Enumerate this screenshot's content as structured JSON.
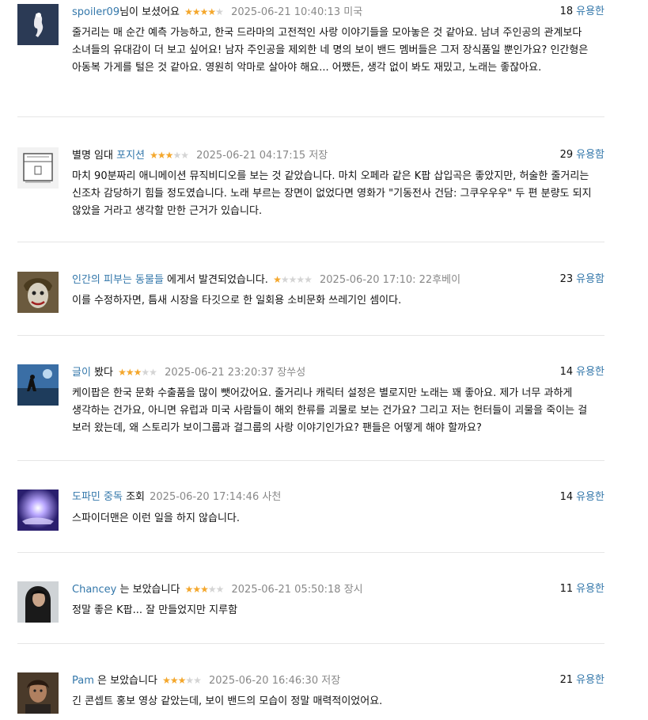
{
  "reviews": [
    {
      "avatar": "ghost-figure-avatar",
      "user": "spoiler09",
      "action": "님이 보셨어요",
      "rating": 4,
      "time": "2025-06-21 10:40:13",
      "location": "미국",
      "votes": "18",
      "vote_label": "유용한",
      "text": "줄거리는 매 순간 예측 가능하고, 한국 드라마의 고전적인 사랑 이야기들을 모아놓은 것 같아요. 남녀 주인공의 관계보다 소녀들의 유대감이 더 보고 싶어요! 남자 주인공을 제외한 네 명의 보이 밴드 멤버들은 그저 장식품일 뿐인가요? 인간형은 아동복 가게를 털은 것 같아요. 영원히 악마로 살아야 해요... 어쨌든, 생각 없이 봐도 재밌고, 노래는 좋잖아요."
    },
    {
      "avatar": "sketch-building-avatar",
      "user": "포지션",
      "user_prefix": "별명 임대",
      "action": "",
      "rating": 3,
      "time": "2025-06-21 04:17:15",
      "location": "저장",
      "votes": "29",
      "vote_label": "유용함",
      "text": "마치 90분짜리 애니메이션 뮤직비디오를 보는 것 같았습니다. 마치 오페라 같은 K팝 삽입곡은 좋았지만, 허술한 줄거리는 신조차 감당하기 힘들 정도였습니다. 노래 부르는 장면이 없었다면 영화가 \"기동전사 건담: 그쿠우우우\" 두 편 분량도 되지 않았을 거라고 생각할 만한 근거가 있습니다."
    },
    {
      "avatar": "joker-face-avatar",
      "user": "인간의 피부는 동물들",
      "action": "에게서 발견되었습니다.",
      "rating": 1,
      "time": "2025-06-20 17:10: 22후베이",
      "location": "",
      "votes": "23",
      "vote_label": "유용함",
      "text": "이를 수정하자면, 틈새 시장을 타깃으로 한 일회용 소비문화 쓰레기인 셈이다."
    },
    {
      "avatar": "stage-scene-avatar",
      "user": "글이",
      "action": "봤다",
      "rating": 3,
      "time": "2025-06-21 23:20:37",
      "location": "장쑤성",
      "votes": "14",
      "vote_label": "유용한",
      "text": "케이팝은 한국 문화 수출품을 많이 뺏어갔어요. 줄거리나 캐릭터 설정은 별로지만 노래는 꽤 좋아요. 제가 너무 과하게 생각하는 건가요, 아니면 유럽과 미국 사람들이 해외 한류를 괴물로 보는 건가요? 그리고 저는 헌터들이 괴물을 죽이는 걸 보러 왔는데, 왜 스토리가 보이그룹과 걸그룹의 사랑 이야기인가요? 팬들은 어떻게 해야 할까요?"
    },
    {
      "avatar": "glowing-hand-avatar",
      "user": "도파민 중독",
      "action": "조회",
      "rating": 0,
      "time": "2025-06-20 17:14:46",
      "location": "사천",
      "votes": "14",
      "vote_label": "유용한",
      "text": "스파이더맨은 이런 일을 하지 않습니다."
    },
    {
      "avatar": "dark-hair-woman-avatar",
      "user": "Chancey",
      "action": "는 보았습니다",
      "rating": 3,
      "time": "2025-06-21 05:50:18",
      "location": "장시",
      "votes": "11",
      "vote_label": "유용한",
      "text": "정말 좋은 K팝... 잘 만들었지만 지루함"
    },
    {
      "avatar": "portrait-woman-avatar",
      "user": "Pam",
      "action": "은 보았습니다",
      "rating": 3,
      "time": "2025-06-20 16:46:30",
      "location": "저장",
      "votes": "21",
      "vote_label": "유용한",
      "text": "긴 콘셉트 홍보 영상 같았는데, 보이 밴드의 모습이 정말 매력적이었어요."
    }
  ],
  "colors": {
    "link": "#3377aa",
    "star_on": "#f4a72c",
    "star_off": "#d4d4d4",
    "muted": "#888888",
    "divider": "#e6e6e6"
  }
}
